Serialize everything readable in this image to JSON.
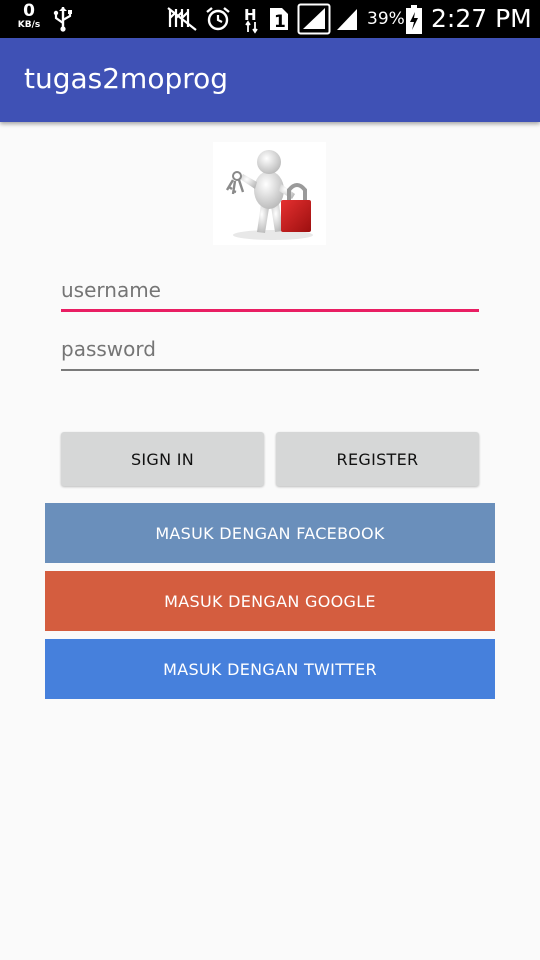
{
  "status_bar": {
    "speed_value": "0",
    "speed_unit": "KB/s",
    "battery_percent": "39%",
    "time": "2:27 PM",
    "icons": [
      "usb-icon",
      "mute-icon",
      "alarm-icon",
      "h-data-icon",
      "sim1-icon",
      "signal-icon",
      "signal2-icon",
      "battery-charging-icon"
    ]
  },
  "app_bar": {
    "title": "tugas2moprog"
  },
  "logo": {
    "icon": "user-lock-keys-icon"
  },
  "form": {
    "username_placeholder": "username",
    "password_placeholder": "password",
    "username_value": "",
    "password_value": ""
  },
  "buttons": {
    "sign_in": "SIGN IN",
    "register": "REGISTER",
    "facebook": "MASUK DENGAN FACEBOOK",
    "google": "MASUK DENGAN GOOGLE",
    "twitter": "MASUK DENGAN TWITTER"
  },
  "colors": {
    "app_bar": "#3f51b5",
    "accent": "#e91e63",
    "facebook": "#6a8fbb",
    "google": "#d45d3f",
    "twitter": "#4680dc"
  }
}
